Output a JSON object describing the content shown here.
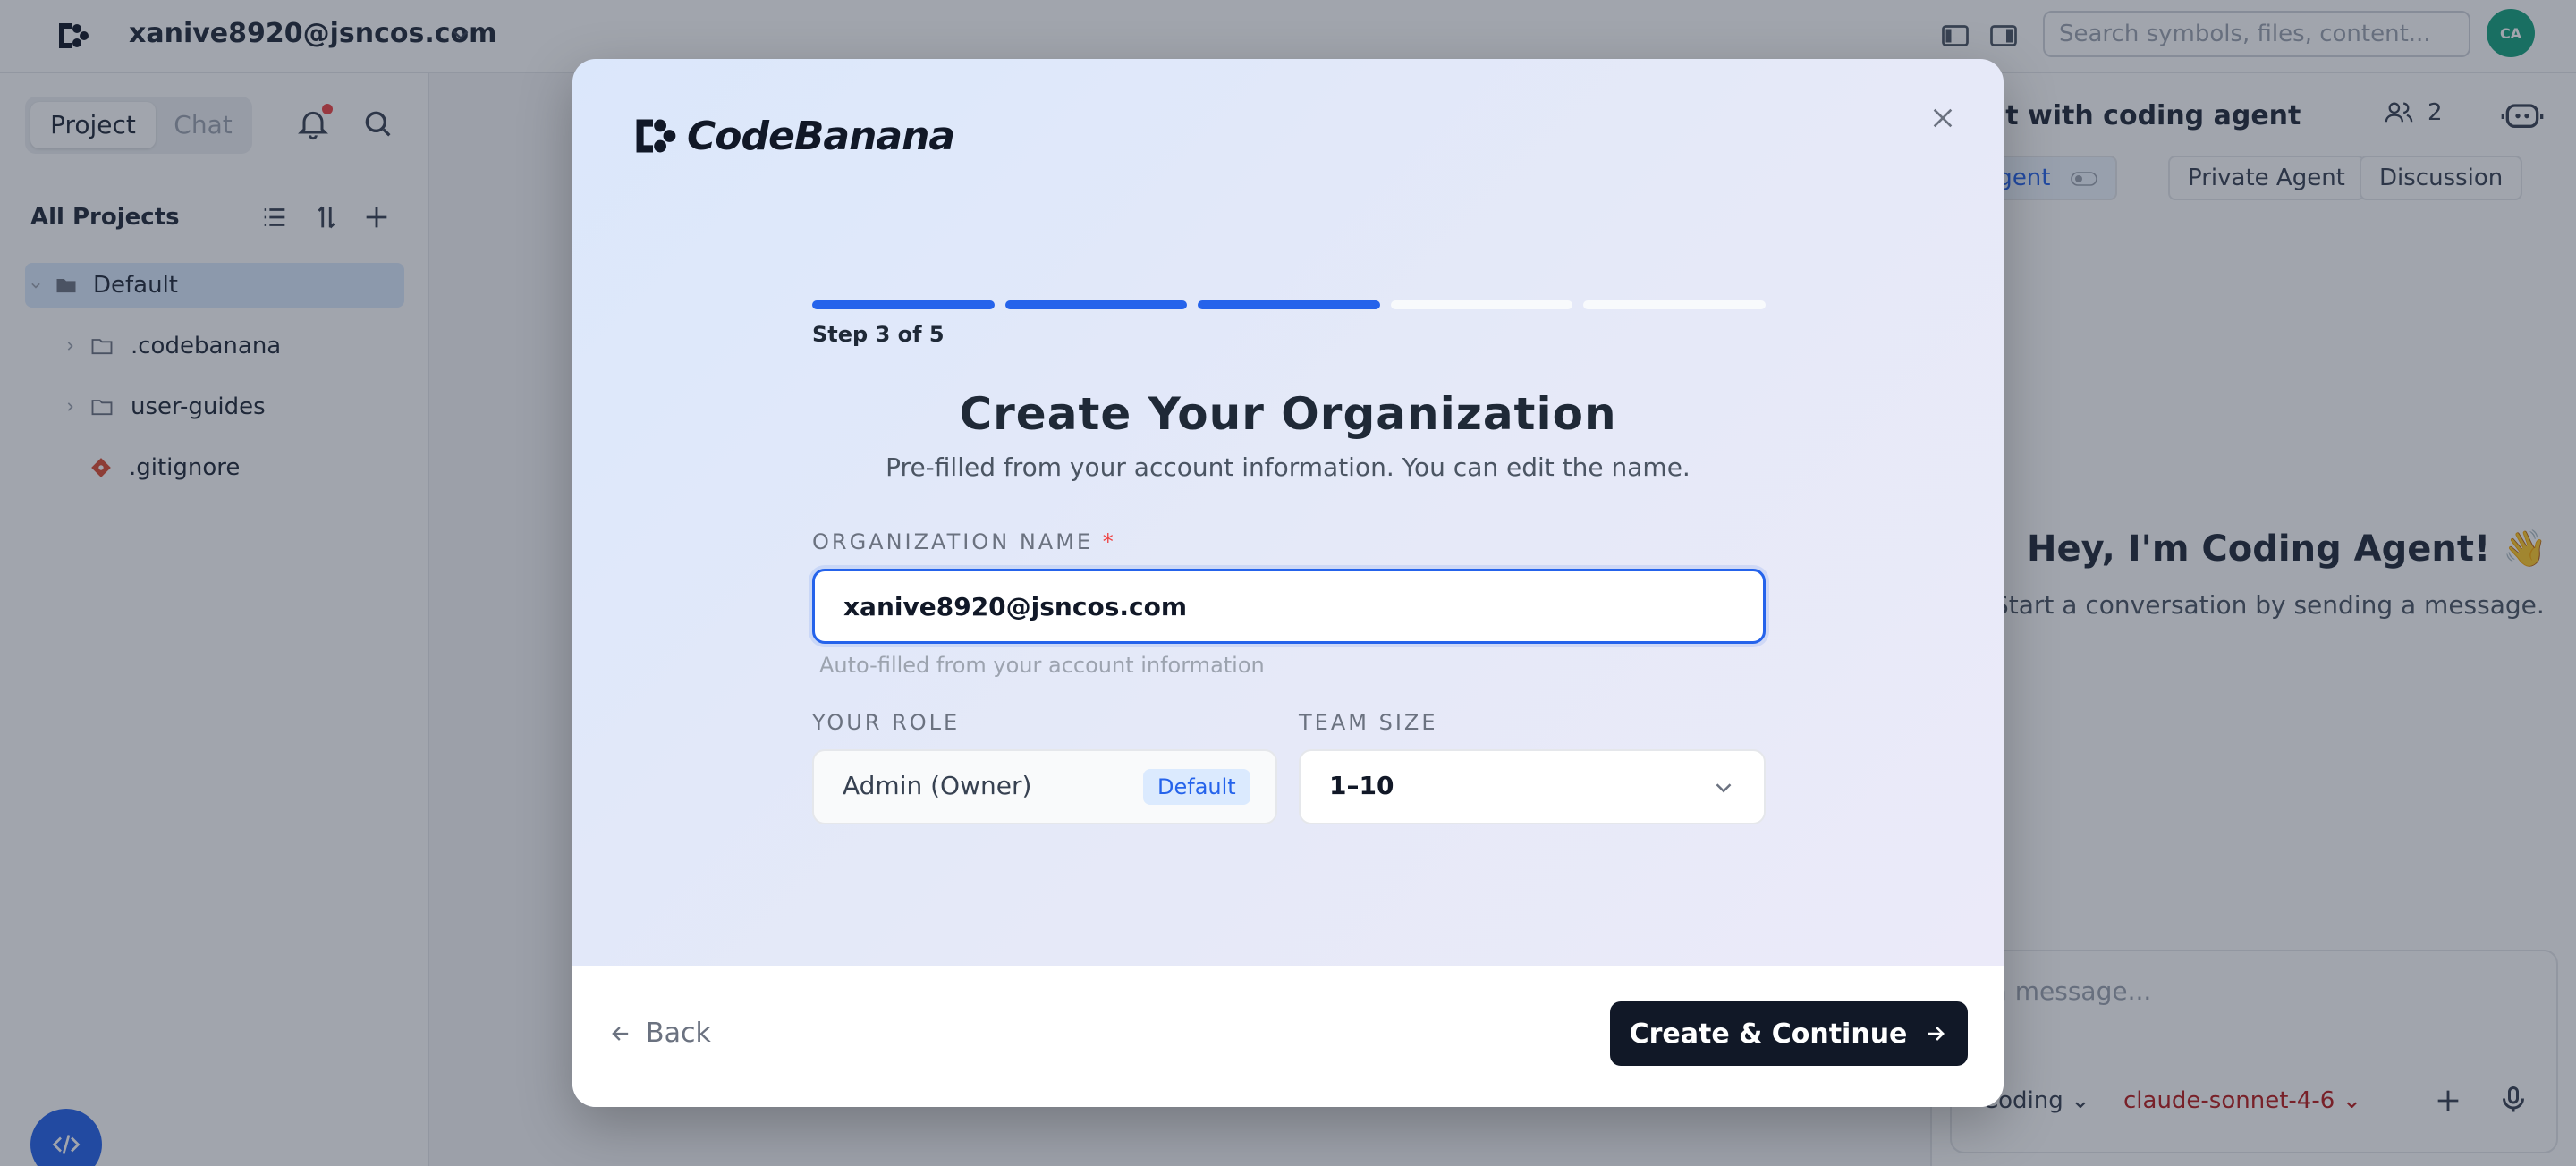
{
  "app": {
    "account": "xanive8920@jsncos.com",
    "search_placeholder": "Search symbols, files, content...",
    "avatar_initials": "CA"
  },
  "sidebar": {
    "tabs": [
      "Project",
      "Chat"
    ],
    "active_tab": "Project",
    "section_title": "All Projects",
    "tree": [
      {
        "label": "Default",
        "type": "folder",
        "selected": true
      },
      {
        "label": ".codebanana",
        "type": "folder"
      },
      {
        "label": "user-guides",
        "type": "folder"
      },
      {
        "label": ".gitignore",
        "type": "git-file"
      }
    ]
  },
  "chat": {
    "title": "at with coding agent",
    "participants": "2",
    "tabs": [
      "am Agent",
      "Private Agent",
      "Discussion"
    ],
    "greeting": "Hey, I'm Coding Agent! 👋",
    "greeting_sub": "Start a conversation by sending a message.",
    "input_placeholder": "d a message...",
    "mode": "Coding",
    "model": "claude-sonnet-4-6"
  },
  "modal": {
    "brand": "CodeBanana",
    "progress": {
      "current": 3,
      "total": 5
    },
    "step_label": "Step 3 of 5",
    "title": "Create Your Organization",
    "subtitle": "Pre-filled from your account information. You can edit the name.",
    "org_label": "ORGANIZATION NAME",
    "org_required": "*",
    "org_value": "xanive8920@jsncos.com",
    "org_helper": "Auto-filled from your account information",
    "role_label": "YOUR ROLE",
    "role_value": "Admin (Owner)",
    "role_badge": "Default",
    "size_label": "TEAM SIZE",
    "size_value": "1–10",
    "back_label": "Back",
    "primary_label": "Create & Continue"
  },
  "colors": {
    "accent": "#2563eb",
    "primary_button": "#111827"
  }
}
